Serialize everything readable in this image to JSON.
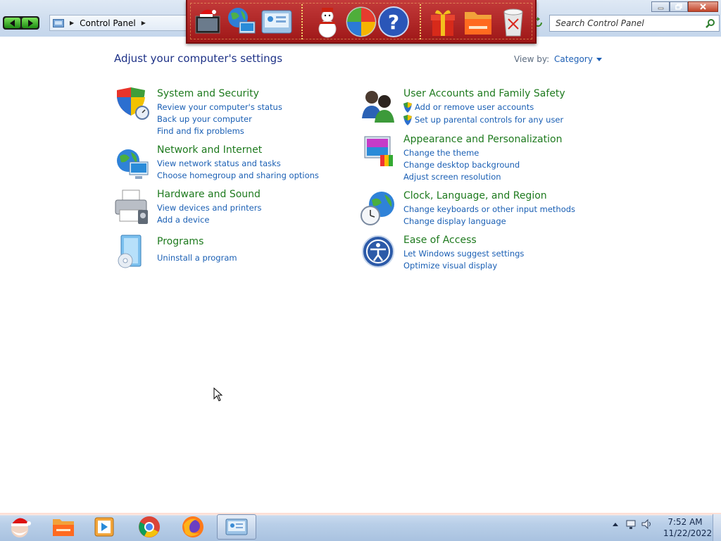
{
  "window": {
    "breadcrumb": "Control Panel",
    "search_placeholder": "Search Control Panel"
  },
  "dock": {
    "icons": [
      "desktop-santa-icon",
      "globe-computer-icon",
      "control-panel-icon",
      "snowman-icon",
      "windows-logo-icon",
      "help-icon",
      "gift-icon",
      "folder-icon",
      "recycle-bin-icon"
    ]
  },
  "content": {
    "heading": "Adjust your computer's settings",
    "view_by_label": "View by:",
    "view_by_value": "Category",
    "categories": [
      {
        "title": "System and Security",
        "icon": "shield-icon",
        "links": [
          "Review your computer's status",
          "Back up your computer",
          "Find and fix problems"
        ]
      },
      {
        "title": "Network and Internet",
        "icon": "network-icon",
        "links": [
          "View network status and tasks",
          "Choose homegroup and sharing options"
        ]
      },
      {
        "title": "Hardware and Sound",
        "icon": "printer-icon",
        "links": [
          "View devices and printers",
          "Add a device"
        ]
      },
      {
        "title": "Programs",
        "icon": "programs-icon",
        "links": [
          "Uninstall a program"
        ]
      },
      {
        "title": "User Accounts and Family Safety",
        "icon": "users-icon",
        "links": [
          "Add or remove user accounts",
          "Set up parental controls for any user"
        ]
      },
      {
        "title": "Appearance and Personalization",
        "icon": "monitor-paint-icon",
        "links": [
          "Change the theme",
          "Change desktop background",
          "Adjust screen resolution"
        ]
      },
      {
        "title": "Clock, Language, and Region",
        "icon": "clock-globe-icon",
        "links": [
          "Change keyboards or other input methods",
          "Change display language"
        ]
      },
      {
        "title": "Ease of Access",
        "icon": "ease-of-access-icon",
        "links": [
          "Let Windows suggest settings",
          "Optimize visual display"
        ]
      }
    ]
  },
  "taskbar": {
    "items": [
      "santa-start-icon",
      "folder-icon",
      "media-player-icon",
      "chrome-icon",
      "firefox-icon",
      "control-panel-icon"
    ],
    "clock_time": "7:52 AM",
    "clock_date": "11/22/2022"
  },
  "colors": {
    "category_title": "#1e7a1e",
    "link": "#1a5fb4",
    "heading": "#1e3287",
    "dock_red": "#b22222"
  }
}
